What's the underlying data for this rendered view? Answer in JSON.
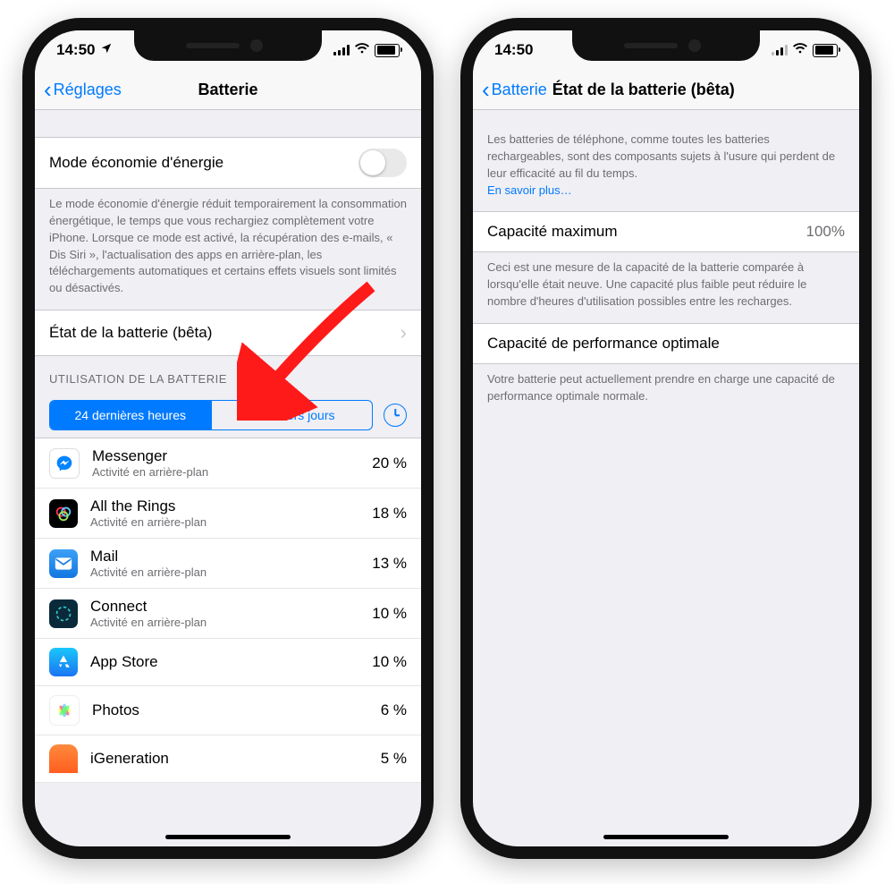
{
  "phone_left": {
    "statusbar": {
      "time": "14:50"
    },
    "nav": {
      "back": "Réglages",
      "title": "Batterie"
    },
    "low_power": {
      "label": "Mode économie d'énergie",
      "desc": "Le mode économie d'énergie réduit temporairement la consommation énergétique, le temps que vous rechargiez complètement votre iPhone. Lorsque ce mode est activé, la récupération des e-mails, « Dis Siri », l'actualisation des apps en arrière-plan, les téléchargements automatiques et certains effets visuels sont limités ou désactivés."
    },
    "battery_state": {
      "label": "État de la batterie (bêta)"
    },
    "usage": {
      "header": "UTILISATION DE LA BATTERIE",
      "seg_a": "24 dernières heures",
      "seg_b": "7 derniers jours",
      "apps": [
        {
          "name": "Messenger",
          "sub": "Activité en arrière-plan",
          "pct": "20 %",
          "icon": "messenger"
        },
        {
          "name": "All the Rings",
          "sub": "Activité en arrière-plan",
          "pct": "18 %",
          "icon": "rings"
        },
        {
          "name": "Mail",
          "sub": "Activité en arrière-plan",
          "pct": "13 %",
          "icon": "mail"
        },
        {
          "name": "Connect",
          "sub": "Activité en arrière-plan",
          "pct": "10 %",
          "icon": "connect"
        },
        {
          "name": "App Store",
          "sub": "",
          "pct": "10 %",
          "icon": "appstore"
        },
        {
          "name": "Photos",
          "sub": "",
          "pct": "6 %",
          "icon": "photos"
        },
        {
          "name": "iGeneration",
          "sub": "",
          "pct": "5 %",
          "icon": "igen"
        }
      ]
    }
  },
  "phone_right": {
    "statusbar": {
      "time": "14:50"
    },
    "nav": {
      "back": "Batterie",
      "title": "État de la batterie (bêta)"
    },
    "intro": {
      "text": "Les batteries de téléphone, comme toutes les batteries rechargeables, sont des composants sujets à l'usure qui perdent de leur efficacité au fil du temps.",
      "link": "En savoir plus…"
    },
    "capacity": {
      "label": "Capacité maximum",
      "value": "100%",
      "desc": "Ceci est une mesure de la capacité de la batterie comparée à lorsqu'elle était neuve. Une capacité plus faible peut réduire le nombre d'heures d'utilisation possibles entre les recharges."
    },
    "perf": {
      "label": "Capacité de performance optimale",
      "desc": "Votre batterie peut actuellement prendre en charge une capacité de performance optimale normale."
    }
  }
}
